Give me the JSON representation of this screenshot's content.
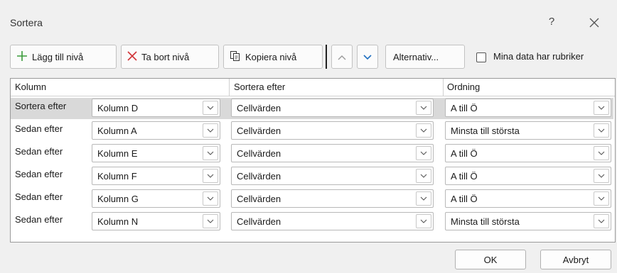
{
  "dialog": {
    "title": "Sortera",
    "help": "?",
    "icons": {
      "help": "question-mark-icon",
      "close": "close-icon"
    }
  },
  "toolbar": {
    "add_level": "Lägg till nivå",
    "delete_level": "Ta bort nivå",
    "copy_level": "Kopiera nivå",
    "options": "Alternativ...",
    "has_headers": "Mina data har rubriker",
    "has_headers_checked": false,
    "colors": {
      "add_icon": "#3a9b3a",
      "delete_icon": "#d13438",
      "down_arrow": "#1f6fc0"
    }
  },
  "grid": {
    "headers": [
      "Kolumn",
      "Sortera efter",
      "Ordning"
    ],
    "rows": [
      {
        "label": "Sortera efter",
        "column": "Kolumn D",
        "sort_on": "Cellvärden",
        "order": "A till Ö",
        "selected": true
      },
      {
        "label": "Sedan efter",
        "column": "Kolumn A",
        "sort_on": "Cellvärden",
        "order": "Minsta till största",
        "selected": false
      },
      {
        "label": "Sedan efter",
        "column": "Kolumn E",
        "sort_on": "Cellvärden",
        "order": "A till Ö",
        "selected": false
      },
      {
        "label": "Sedan efter",
        "column": "Kolumn F",
        "sort_on": "Cellvärden",
        "order": "A till Ö",
        "selected": false
      },
      {
        "label": "Sedan efter",
        "column": "Kolumn G",
        "sort_on": "Cellvärden",
        "order": "A till Ö",
        "selected": false
      },
      {
        "label": "Sedan efter",
        "column": "Kolumn N",
        "sort_on": "Cellvärden",
        "order": "Minsta till största",
        "selected": false
      }
    ]
  },
  "footer": {
    "ok": "OK",
    "cancel": "Avbryt"
  }
}
